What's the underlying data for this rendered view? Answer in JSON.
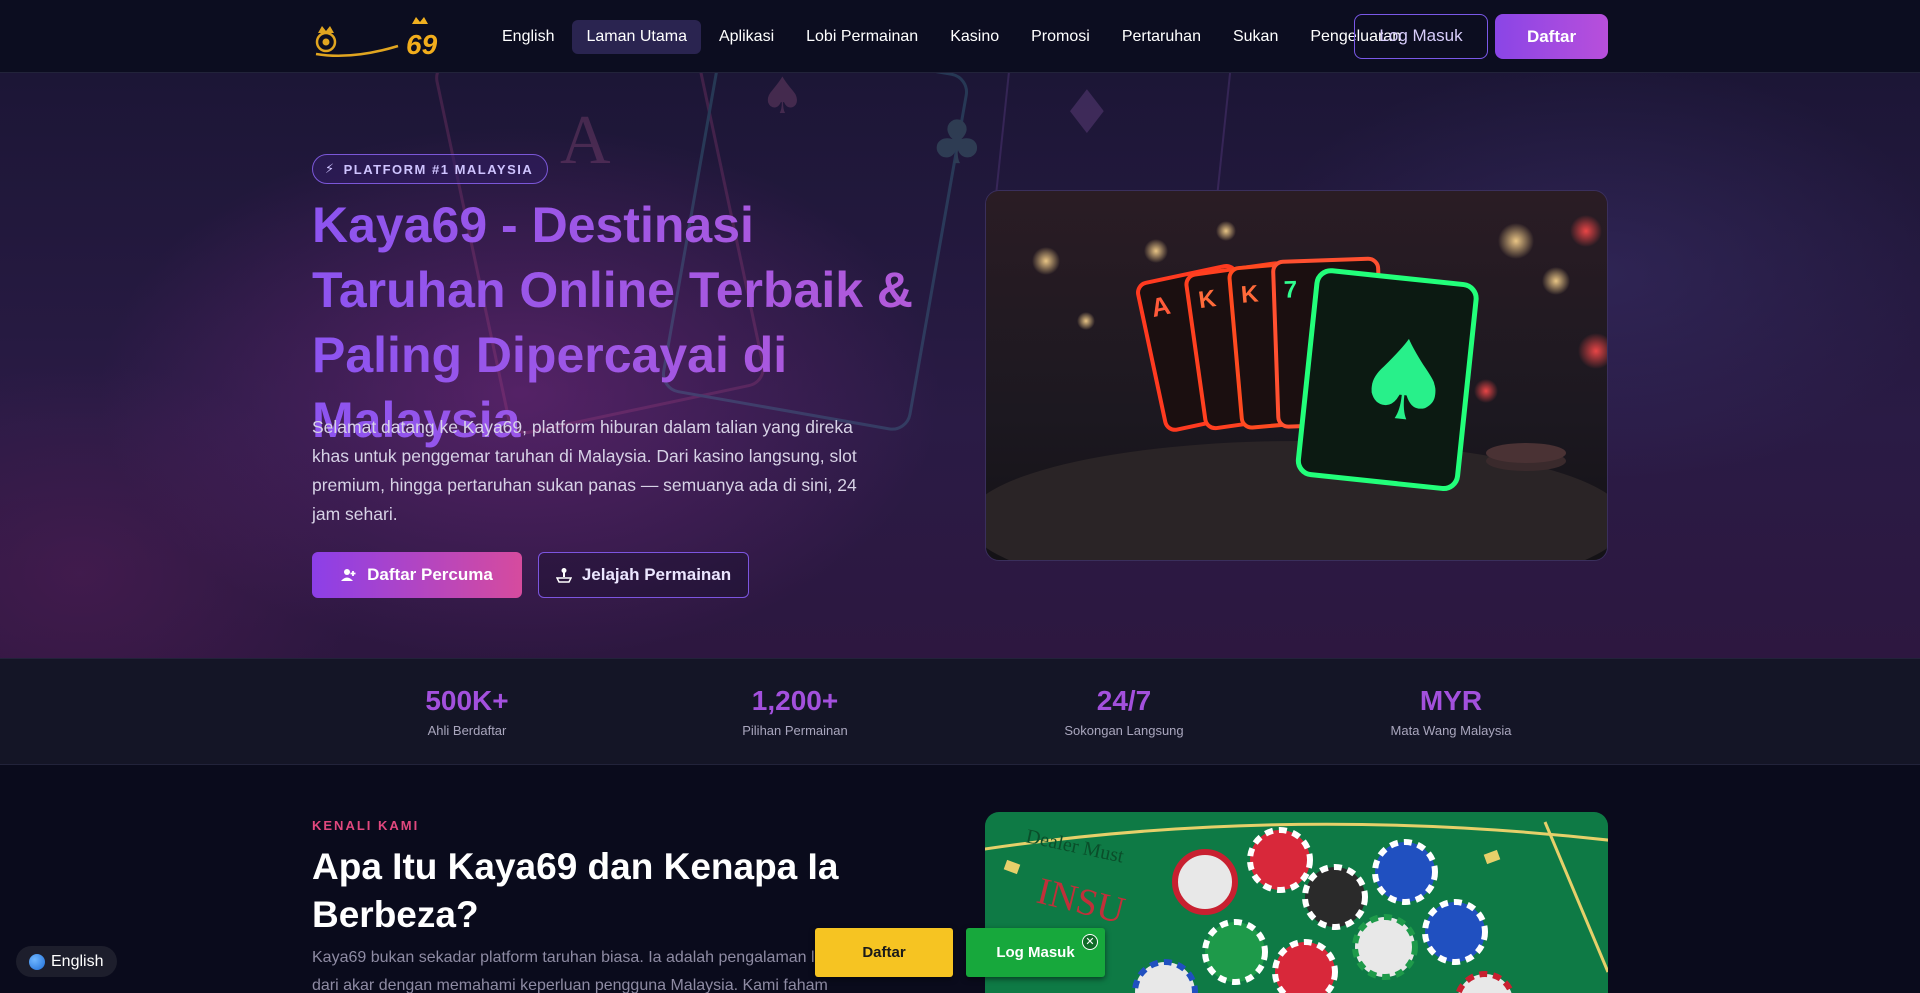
{
  "header": {
    "logo_text": "69",
    "nav": [
      {
        "label": "English",
        "active": false
      },
      {
        "label": "Laman Utama",
        "active": true
      },
      {
        "label": "Aplikasi",
        "active": false
      },
      {
        "label": "Lobi Permainan",
        "active": false
      },
      {
        "label": "Kasino",
        "active": false
      },
      {
        "label": "Promosi",
        "active": false
      },
      {
        "label": "Pertaruhan",
        "active": false
      },
      {
        "label": "Sukan",
        "active": false
      },
      {
        "label": "Pengeluaran",
        "active": false
      }
    ],
    "login_label": "Log Masuk",
    "register_label": "Daftar"
  },
  "hero": {
    "badge": "PLATFORM #1 MALAYSIA",
    "title": "Kaya69 - Destinasi Taruhan Online Terbaik & Paling Dipercayai di Malaysia",
    "description": "Selamat datang ke Kaya69, platform hiburan dalam talian yang direka khas untuk penggemar taruhan di Malaysia. Dari kasino langsung, slot premium, hingga pertaruhan sukan panas — semuanya ada di sini, 24 jam sehari.",
    "cta_primary": "Daftar Percuma",
    "cta_secondary": "Jelajah Permainan"
  },
  "stats": [
    {
      "value": "500K+",
      "label": "Ahli Berdaftar"
    },
    {
      "value": "1,200+",
      "label": "Pilihan Permainan"
    },
    {
      "value": "24/7",
      "label": "Sokongan Langsung"
    },
    {
      "value": "MYR",
      "label": "Mata Wang Malaysia"
    }
  ],
  "about": {
    "kicker": "KENALI KAMI",
    "title": "Apa Itu Kaya69 dan Kenapa Ia Berbeza?",
    "text": "Kaya69 bukan sekadar platform taruhan biasa. Ia adalah pengalaman l... yang dibina dari akar dengan memahami keperluan pengguna Malaysia. Kami faham"
  },
  "floating": {
    "language": "English",
    "daftar": "Daftar",
    "login": "Log Masuk",
    "close": "✕"
  },
  "colors": {
    "accent_purple": "#8a45e6",
    "accent_pink": "#d64b9e",
    "stat_purple": "#a350dd",
    "kicker_pink": "#e2487e",
    "float_yellow": "#f6c422",
    "float_green": "#17a83c"
  }
}
